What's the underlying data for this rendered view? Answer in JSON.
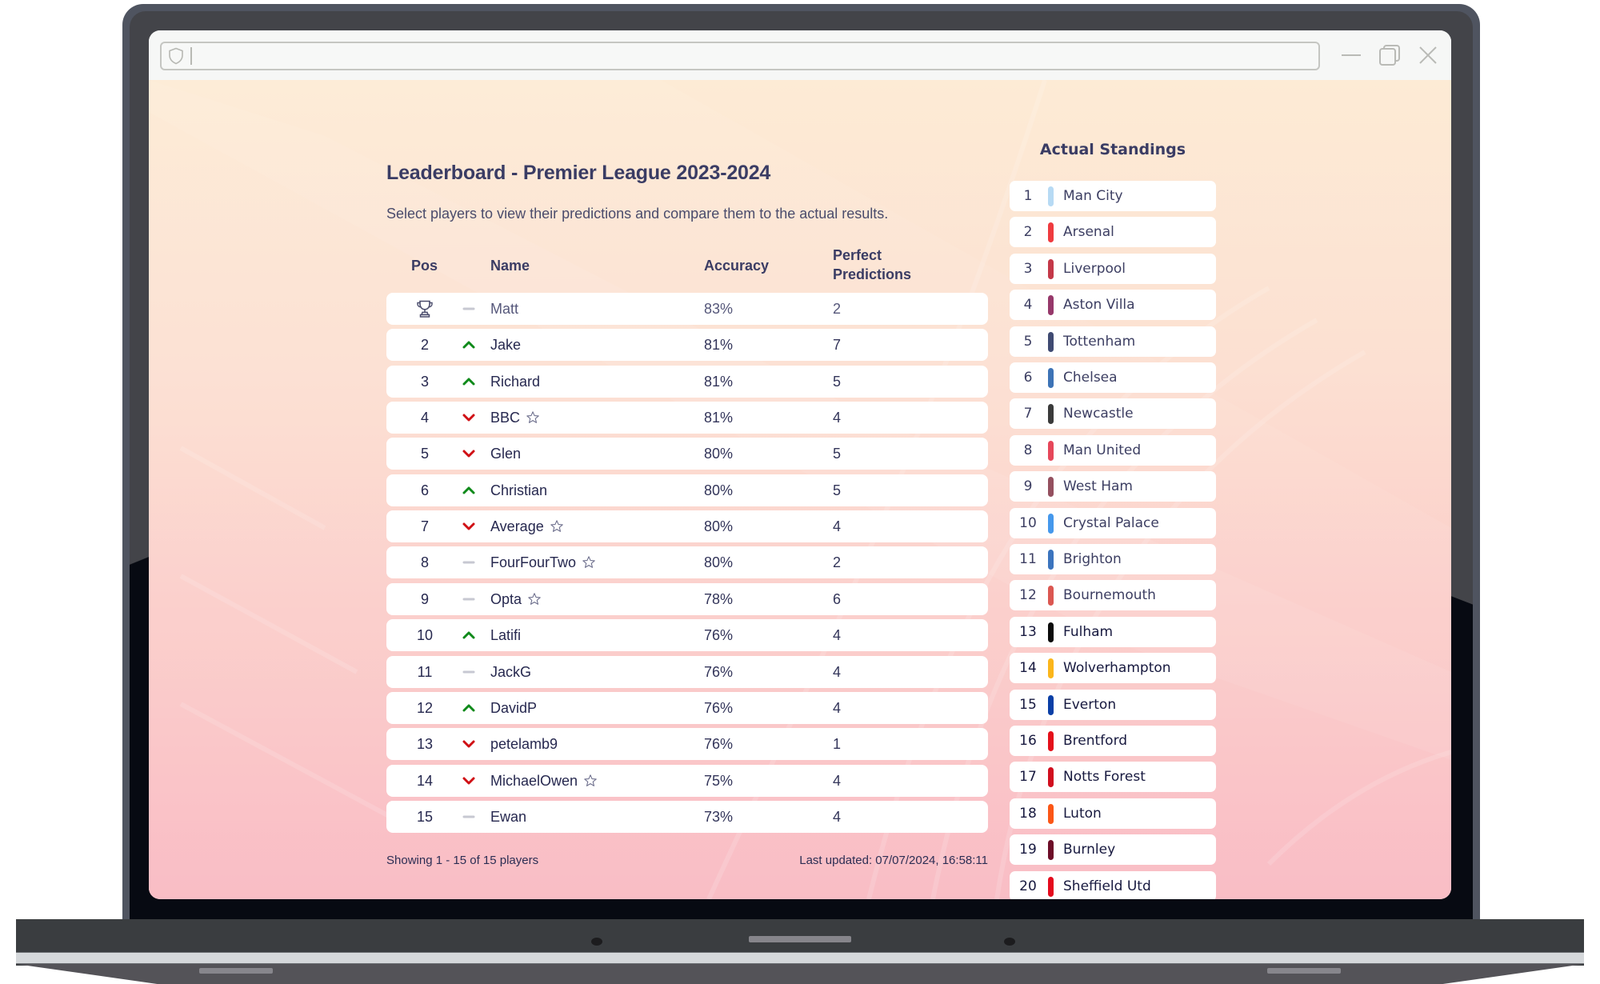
{
  "browser": {
    "address_bar_value": "",
    "icons": {
      "address": "shield-icon",
      "minimize": "minimize-icon",
      "restore": "restore-icon",
      "close": "close-icon"
    }
  },
  "leaderboard": {
    "title": "Leaderboard - Premier League 2023-2024",
    "subtitle": "Select players to view their predictions and compare them to the actual results.",
    "columns": {
      "pos": "Pos",
      "name": "Name",
      "accuracy": "Accuracy",
      "perfect": "Perfect Predictions"
    },
    "rows": [
      {
        "pos": "1",
        "pos_icon": "trophy-icon",
        "trend": "same",
        "name": "Matt",
        "starred": false,
        "accuracy": "83%",
        "perfect": "2"
      },
      {
        "pos": "2",
        "trend": "up",
        "name": "Jake",
        "starred": false,
        "accuracy": "81%",
        "perfect": "7"
      },
      {
        "pos": "3",
        "trend": "up",
        "name": "Richard",
        "starred": false,
        "accuracy": "81%",
        "perfect": "5"
      },
      {
        "pos": "4",
        "trend": "down",
        "name": "BBC",
        "starred": true,
        "accuracy": "81%",
        "perfect": "4"
      },
      {
        "pos": "5",
        "trend": "down",
        "name": "Glen",
        "starred": false,
        "accuracy": "80%",
        "perfect": "5"
      },
      {
        "pos": "6",
        "trend": "up",
        "name": "Christian",
        "starred": false,
        "accuracy": "80%",
        "perfect": "5"
      },
      {
        "pos": "7",
        "trend": "down",
        "name": "Average",
        "starred": true,
        "accuracy": "80%",
        "perfect": "4"
      },
      {
        "pos": "8",
        "trend": "same",
        "name": "FourFourTwo",
        "starred": true,
        "accuracy": "80%",
        "perfect": "2"
      },
      {
        "pos": "9",
        "trend": "same",
        "name": "Opta",
        "starred": true,
        "accuracy": "78%",
        "perfect": "6"
      },
      {
        "pos": "10",
        "trend": "up",
        "name": "Latifi",
        "starred": false,
        "accuracy": "76%",
        "perfect": "4"
      },
      {
        "pos": "11",
        "trend": "same",
        "name": "JackG",
        "starred": false,
        "accuracy": "76%",
        "perfect": "4"
      },
      {
        "pos": "12",
        "trend": "up",
        "name": "DavidP",
        "starred": false,
        "accuracy": "76%",
        "perfect": "4"
      },
      {
        "pos": "13",
        "trend": "down",
        "name": "petelamb9",
        "starred": false,
        "accuracy": "76%",
        "perfect": "1"
      },
      {
        "pos": "14",
        "trend": "down",
        "name": "MichaelOwen",
        "starred": true,
        "accuracy": "75%",
        "perfect": "4"
      },
      {
        "pos": "15",
        "trend": "same",
        "name": "Ewan",
        "starred": false,
        "accuracy": "73%",
        "perfect": "4"
      }
    ],
    "footer_left": "Showing 1 - 15 of 15 players",
    "footer_right": "Last updated: 07/07/2024, 16:58:11"
  },
  "standings": {
    "title": "Actual Standings",
    "teams": [
      {
        "pos": "1",
        "name": "Man City",
        "color": "#b7daf4"
      },
      {
        "pos": "2",
        "name": "Arsenal",
        "color": "#ef3b3f"
      },
      {
        "pos": "3",
        "name": "Liverpool",
        "color": "#c43848"
      },
      {
        "pos": "4",
        "name": "Aston Villa",
        "color": "#96386a"
      },
      {
        "pos": "5",
        "name": "Tottenham",
        "color": "#3f4a72"
      },
      {
        "pos": "6",
        "name": "Chelsea",
        "color": "#3d73b6"
      },
      {
        "pos": "7",
        "name": "Newcastle",
        "color": "#3a3a3a"
      },
      {
        "pos": "8",
        "name": "Man United",
        "color": "#e6475a"
      },
      {
        "pos": "9",
        "name": "West Ham",
        "color": "#94505f"
      },
      {
        "pos": "10",
        "name": "Crystal Palace",
        "color": "#4598ec"
      },
      {
        "pos": "11",
        "name": "Brighton",
        "color": "#3b74be"
      },
      {
        "pos": "12",
        "name": "Bournemouth",
        "color": "#db5751"
      },
      {
        "pos": "13",
        "name": "Fulham",
        "color": "#0b0b0b"
      },
      {
        "pos": "14",
        "name": "Wolverhampton",
        "color": "#fbb61b"
      },
      {
        "pos": "15",
        "name": "Everton",
        "color": "#0a3fa6"
      },
      {
        "pos": "16",
        "name": "Brentford",
        "color": "#e4101a"
      },
      {
        "pos": "17",
        "name": "Notts Forest",
        "color": "#d10e1e"
      },
      {
        "pos": "18",
        "name": "Luton",
        "color": "#fb5616"
      },
      {
        "pos": "19",
        "name": "Burnley",
        "color": "#6d0d28"
      },
      {
        "pos": "20",
        "name": "Sheffield Utd",
        "color": "#e40b1d"
      }
    ]
  },
  "colors": {
    "trend_up": "#0f8a1a",
    "trend_down": "#d01015",
    "trend_same": "#c7c8d2",
    "text_primary": "#3a3c64"
  }
}
